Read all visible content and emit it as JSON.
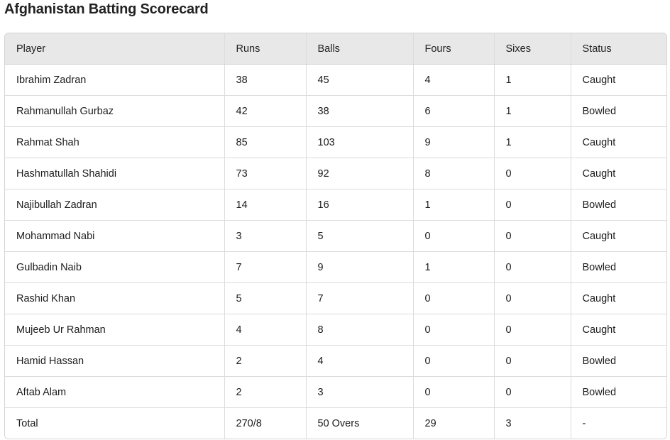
{
  "title": "Afghanistan Batting Scorecard",
  "table": {
    "headers": [
      "Player",
      "Runs",
      "Balls",
      "Fours",
      "Sixes",
      "Status"
    ],
    "rows": [
      [
        "Ibrahim Zadran",
        "38",
        "45",
        "4",
        "1",
        "Caught"
      ],
      [
        "Rahmanullah Gurbaz",
        "42",
        "38",
        "6",
        "1",
        "Bowled"
      ],
      [
        "Rahmat Shah",
        "85",
        "103",
        "9",
        "1",
        "Caught"
      ],
      [
        "Hashmatullah Shahidi",
        "73",
        "92",
        "8",
        "0",
        "Caught"
      ],
      [
        "Najibullah Zadran",
        "14",
        "16",
        "1",
        "0",
        "Bowled"
      ],
      [
        "Mohammad Nabi",
        "3",
        "5",
        "0",
        "0",
        "Caught"
      ],
      [
        "Gulbadin Naib",
        "7",
        "9",
        "1",
        "0",
        "Bowled"
      ],
      [
        "Rashid Khan",
        "5",
        "7",
        "0",
        "0",
        "Caught"
      ],
      [
        "Mujeeb Ur Rahman",
        "4",
        "8",
        "0",
        "0",
        "Caught"
      ],
      [
        "Hamid Hassan",
        "2",
        "4",
        "0",
        "0",
        "Bowled"
      ],
      [
        "Aftab Alam",
        "2",
        "3",
        "0",
        "0",
        "Bowled"
      ]
    ],
    "total": [
      "Total",
      "270/8",
      "50 Overs",
      "29",
      "3",
      "-"
    ]
  }
}
